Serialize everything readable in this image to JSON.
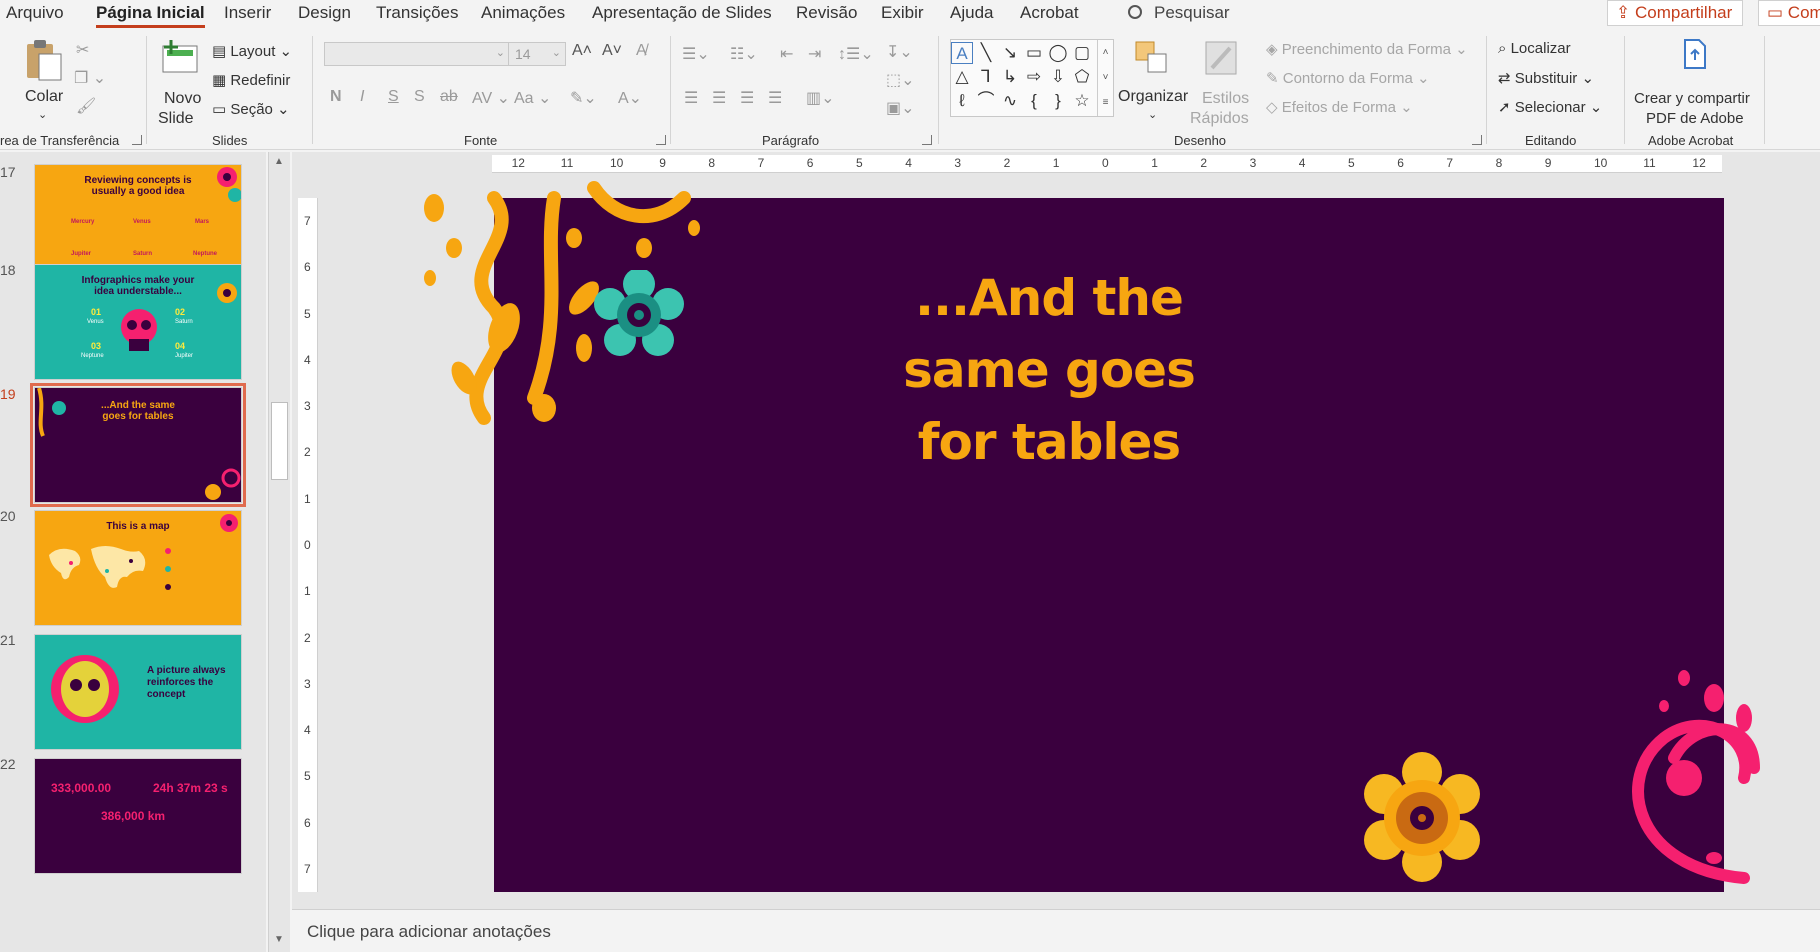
{
  "tabs": [
    "Arquivo",
    "Página Inicial",
    "Inserir",
    "Design",
    "Transições",
    "Animações",
    "Apresentação de Slides",
    "Revisão",
    "Exibir",
    "Ajuda",
    "Acrobat"
  ],
  "active_tab": "Página Inicial",
  "search": {
    "label": "Pesquisar"
  },
  "share": {
    "label": "Compartilhar",
    "comments_label": "Com"
  },
  "clipboard": {
    "paste": "Colar",
    "group": "rea de Transferência"
  },
  "slides_group": {
    "new_slide_1": "Novo",
    "new_slide_2": "Slide",
    "layout": "Layout",
    "reset": "Redefinir",
    "section": "Seção",
    "group": "Slides"
  },
  "font_group": {
    "size": "14",
    "bold": "N",
    "italic": "I",
    "underline": "S",
    "shadow": "S",
    "strike": "ab",
    "spacing": "AV",
    "case": "Aa",
    "group": "Fonte"
  },
  "paragraph_group": {
    "group": "Parágrafo"
  },
  "drawing_group": {
    "arrange": "Organizar",
    "quick_styles_1": "Estilos",
    "quick_styles_2": "Rápidos",
    "shape_fill": "Preenchimento da Forma",
    "shape_outline": "Contorno da Forma",
    "shape_effects": "Efeitos de Forma",
    "group": "Desenho"
  },
  "editing_group": {
    "find": "Localizar",
    "replace": "Substituir",
    "select": "Selecionar",
    "group": "Editando"
  },
  "acrobat_group": {
    "create_1": "Crear y compartir",
    "create_2": "PDF de Adobe",
    "group": "Adobe Acrobat"
  },
  "thumbnails": [
    {
      "num": "17",
      "title": "Reviewing concepts is usually a good idea",
      "labels": [
        "Mercury",
        "Venus",
        "Mars",
        "Jupiter",
        "Saturn",
        "Neptune"
      ]
    },
    {
      "num": "18",
      "title": "Infographics make your idea understable...",
      "labels": [
        "01",
        "02",
        "03",
        "04",
        "Venus",
        "Saturn",
        "Neptune",
        "Jupiter"
      ]
    },
    {
      "num": "19",
      "title": "...And the same goes for tables"
    },
    {
      "num": "20",
      "title": "This is a map"
    },
    {
      "num": "21",
      "title": "A picture always reinforces the concept"
    },
    {
      "num": "22",
      "values": [
        "333,000.00",
        "24h 37m 23 s",
        "386,000 km"
      ]
    }
  ],
  "ruler": {
    "h": [
      "12",
      "11",
      "10",
      "9",
      "8",
      "7",
      "6",
      "5",
      "4",
      "3",
      "2",
      "1",
      "0",
      "1",
      "2",
      "3",
      "4",
      "5",
      "6",
      "7",
      "8",
      "9",
      "10",
      "11",
      "12"
    ],
    "v": [
      "7",
      "6",
      "5",
      "4",
      "3",
      "2",
      "1",
      "0",
      "1",
      "2",
      "3",
      "4",
      "5",
      "6",
      "7"
    ]
  },
  "slide": {
    "title": "...And the same goes for tables",
    "bg": "#3a003e",
    "title_color": "#f7a611"
  },
  "notes_placeholder": "Clique para adicionar anotações",
  "colors": {
    "orange": "#f7a611",
    "teal": "#1fb5a5",
    "pink": "#f5206f",
    "accent": "#c43e1c"
  }
}
